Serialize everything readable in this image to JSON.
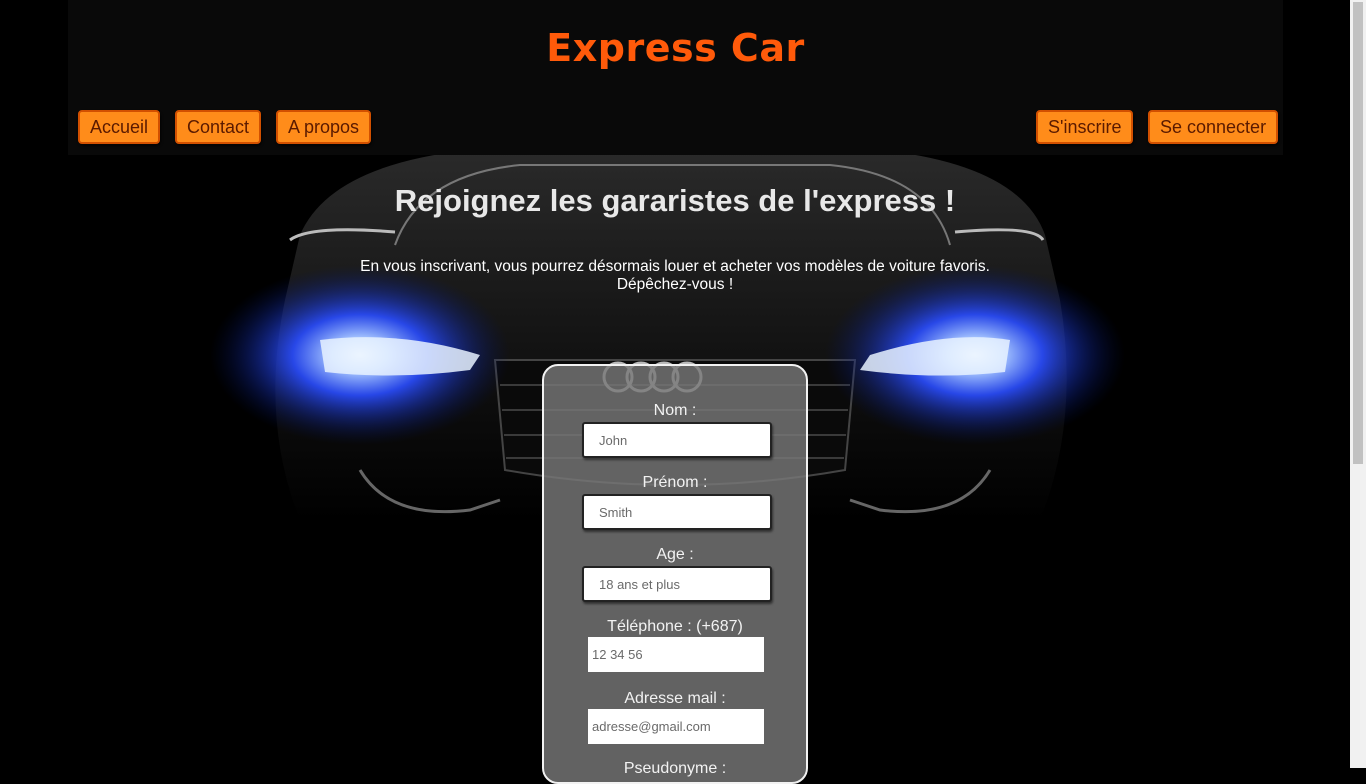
{
  "site": {
    "title": "Express Car"
  },
  "nav": {
    "home": "Accueil",
    "contact": "Contact",
    "about": "A propos",
    "signup": "S'inscrire",
    "login": "Se connecter"
  },
  "main": {
    "heading": "Rejoignez les gararistes de l'express !",
    "intro_line1": "En vous inscrivant, vous pourrez désormais louer et acheter vos modèles de voiture favoris.",
    "intro_line2": "Dépêchez-vous !"
  },
  "form": {
    "nom_label": "Nom :",
    "nom_placeholder": "John",
    "prenom_label": "Prénom :",
    "prenom_placeholder": "Smith",
    "age_label": "Age :",
    "age_placeholder": "18 ans et plus",
    "phone_label": "Téléphone : (+687)",
    "phone_placeholder": "12 34 56",
    "email_label": "Adresse mail :",
    "email_placeholder": "adresse@gmail.com",
    "pseudo_label": "Pseudonyme :"
  },
  "colors": {
    "brand": "#ff5a0a",
    "button": "#ff8c1a",
    "headlight": "#3a5cff"
  },
  "icons": {
    "background": "car-front-image"
  }
}
